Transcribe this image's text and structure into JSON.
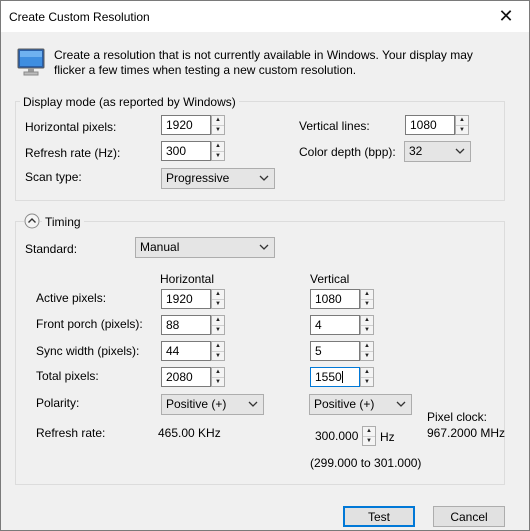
{
  "window": {
    "title": "Create Custom Resolution"
  },
  "info": {
    "text": "Create a resolution that is not currently available in Windows. Your display may flicker a few times when testing a new custom resolution."
  },
  "display_mode": {
    "legend": "Display mode (as reported by Windows)",
    "horizontal_label": "Horizontal pixels:",
    "horizontal_value": "1920",
    "vertical_label": "Vertical lines:",
    "vertical_value": "1080",
    "refresh_label": "Refresh rate (Hz):",
    "refresh_value": "300",
    "color_label": "Color depth (bpp):",
    "color_value": "32",
    "scan_label": "Scan type:",
    "scan_value": "Progressive"
  },
  "timing": {
    "legend": "Timing",
    "standard_label": "Standard:",
    "standard_value": "Manual",
    "col_horizontal": "Horizontal",
    "col_vertical": "Vertical",
    "active_label": "Active pixels:",
    "active_h": "1920",
    "active_v": "1080",
    "front_label": "Front porch (pixels):",
    "front_h": "88",
    "front_v": "4",
    "sync_label": "Sync width (pixels):",
    "sync_h": "44",
    "sync_v": "5",
    "total_label": "Total pixels:",
    "total_h": "2080",
    "total_v": "1550",
    "polarity_label": "Polarity:",
    "polarity_h": "Positive (+)",
    "polarity_v": "Positive (+)",
    "pixel_clock_label": "Pixel clock:",
    "pixel_clock_value": "967.2000 MHz",
    "refresh_label": "Refresh rate:",
    "refresh_h_value": "465.00 KHz",
    "refresh_v_value": "300.000",
    "refresh_v_unit": "Hz",
    "refresh_range": "(299.000 to 301.000)"
  },
  "buttons": {
    "test": "Test",
    "cancel": "Cancel"
  }
}
